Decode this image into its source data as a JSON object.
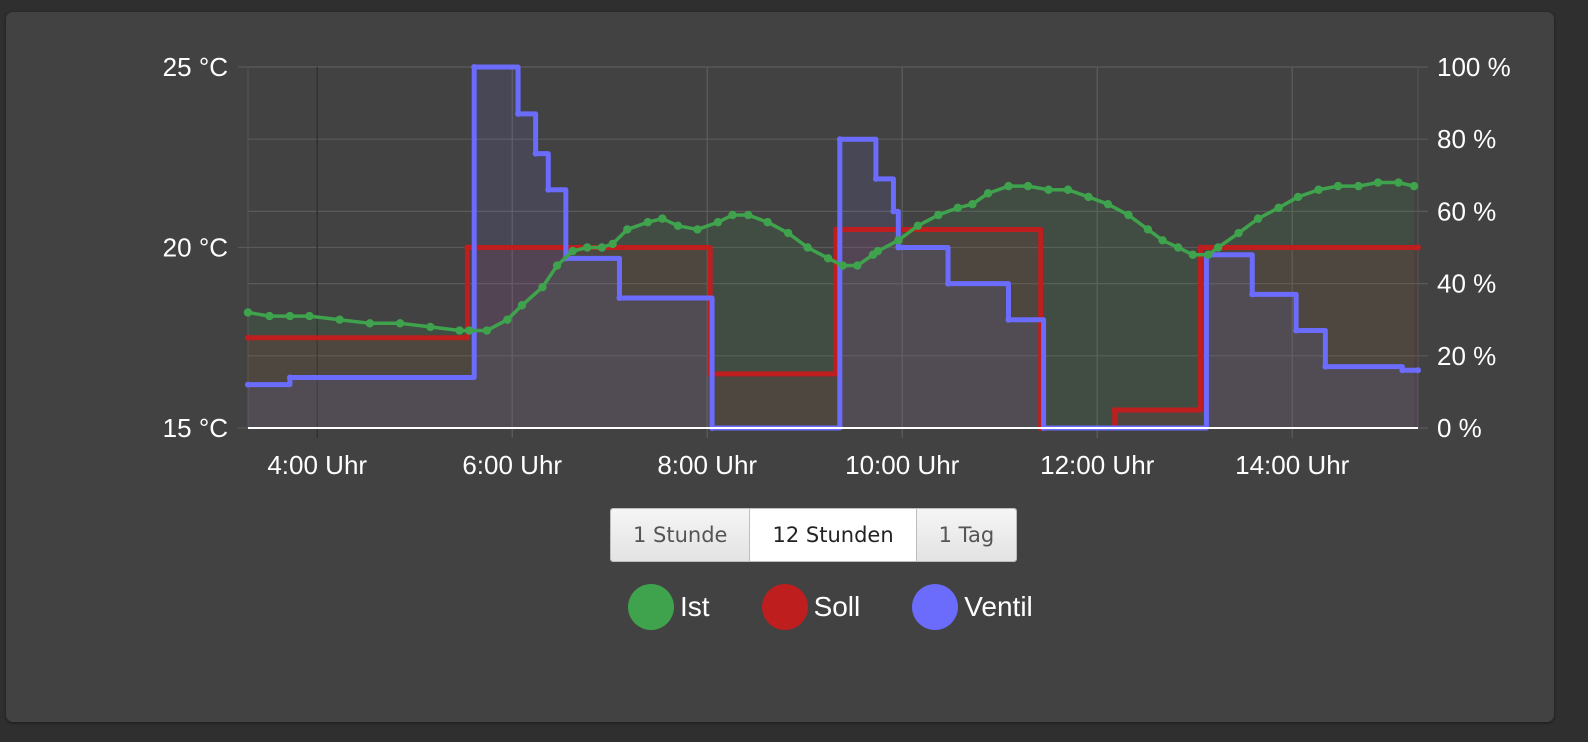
{
  "chart_data": {
    "type": "line",
    "title": "",
    "x_unit": "hour",
    "xlim": [
      3.29,
      15.29
    ],
    "x_ticks": [
      4,
      6,
      8,
      10,
      12,
      14
    ],
    "x_tick_labels": [
      "4:00 Uhr",
      "6:00 Uhr",
      "8:00 Uhr",
      "10:00 Uhr",
      "12:00 Uhr",
      "14:00 Uhr"
    ],
    "y_left": {
      "label": "",
      "ylim": [
        15,
        25
      ],
      "ticks": [
        15,
        20,
        25
      ],
      "tick_labels": [
        "15 °C",
        "20 °C",
        "25 °C"
      ]
    },
    "y_right": {
      "label": "",
      "ylim": [
        0,
        100
      ],
      "ticks": [
        0,
        20,
        40,
        60,
        80,
        100
      ],
      "tick_labels": [
        "0 %",
        "20 %",
        "40 %",
        "60 %",
        "80 %",
        "100 %"
      ]
    },
    "grid": true,
    "legend_position": "bottom",
    "series": [
      {
        "name": "Ist",
        "axis": "left",
        "color": "#3fa34d",
        "style": "line-markers",
        "x": [
          3.29,
          3.51,
          3.72,
          3.92,
          4.23,
          4.54,
          4.85,
          5.16,
          5.46,
          5.56,
          5.74,
          5.95,
          6.1,
          6.31,
          6.46,
          6.62,
          6.77,
          6.92,
          7.03,
          7.18,
          7.39,
          7.54,
          7.7,
          7.9,
          8.11,
          8.26,
          8.42,
          8.62,
          8.83,
          9.03,
          9.24,
          9.39,
          9.54,
          9.7,
          9.75,
          9.96,
          10.16,
          10.37,
          10.57,
          10.72,
          10.88,
          11.09,
          11.29,
          11.5,
          11.7,
          11.91,
          12.11,
          12.32,
          12.52,
          12.67,
          12.83,
          12.98,
          13.14,
          13.24,
          13.45,
          13.65,
          13.86,
          14.06,
          14.27,
          14.47,
          14.68,
          14.88,
          15.09,
          15.25
        ],
        "values": [
          18.2,
          18.1,
          18.1,
          18.1,
          18.0,
          17.9,
          17.9,
          17.8,
          17.7,
          17.7,
          17.7,
          18.0,
          18.4,
          18.9,
          19.5,
          19.9,
          20.0,
          20.0,
          20.1,
          20.5,
          20.7,
          20.8,
          20.6,
          20.5,
          20.7,
          20.9,
          20.9,
          20.7,
          20.4,
          20.0,
          19.7,
          19.5,
          19.5,
          19.8,
          19.9,
          20.2,
          20.6,
          20.9,
          21.1,
          21.2,
          21.5,
          21.7,
          21.7,
          21.6,
          21.6,
          21.4,
          21.2,
          20.9,
          20.5,
          20.2,
          20.0,
          19.8,
          19.8,
          20.0,
          20.4,
          20.8,
          21.1,
          21.4,
          21.6,
          21.7,
          21.7,
          21.8,
          21.8,
          21.7
        ]
      },
      {
        "name": "Soll",
        "axis": "left",
        "color": "#be1e1e",
        "style": "step",
        "x": [
          3.29,
          5.54,
          8.03,
          9.32,
          11.42,
          12.18,
          13.06,
          15.29
        ],
        "values": [
          17.5,
          20.0,
          16.5,
          20.5,
          15.0,
          15.5,
          20.0,
          20.0
        ]
      },
      {
        "name": "Ventil",
        "axis": "right",
        "color": "#6b6bfc",
        "style": "step",
        "x": [
          3.29,
          3.72,
          5.61,
          6.06,
          6.24,
          6.37,
          6.55,
          7.1,
          8.05,
          9.36,
          9.73,
          9.91,
          9.96,
          10.47,
          11.09,
          11.45,
          13.12,
          13.59,
          14.04,
          14.34,
          15.13,
          15.29
        ],
        "values": [
          12,
          14,
          100,
          87,
          76,
          66,
          47,
          36,
          0,
          80,
          69,
          60,
          50,
          40,
          30,
          0,
          48,
          37,
          27,
          17,
          16,
          16
        ]
      }
    ]
  },
  "range_buttons": [
    {
      "label": "1 Stunde",
      "active": false
    },
    {
      "label": "12 Stunden",
      "active": true
    },
    {
      "label": "1 Tag",
      "active": false
    }
  ],
  "legend": [
    {
      "label": "Ist",
      "color": "#3fa34d"
    },
    {
      "label": "Soll",
      "color": "#be1e1e"
    },
    {
      "label": "Ventil",
      "color": "#6b6bfc"
    }
  ]
}
